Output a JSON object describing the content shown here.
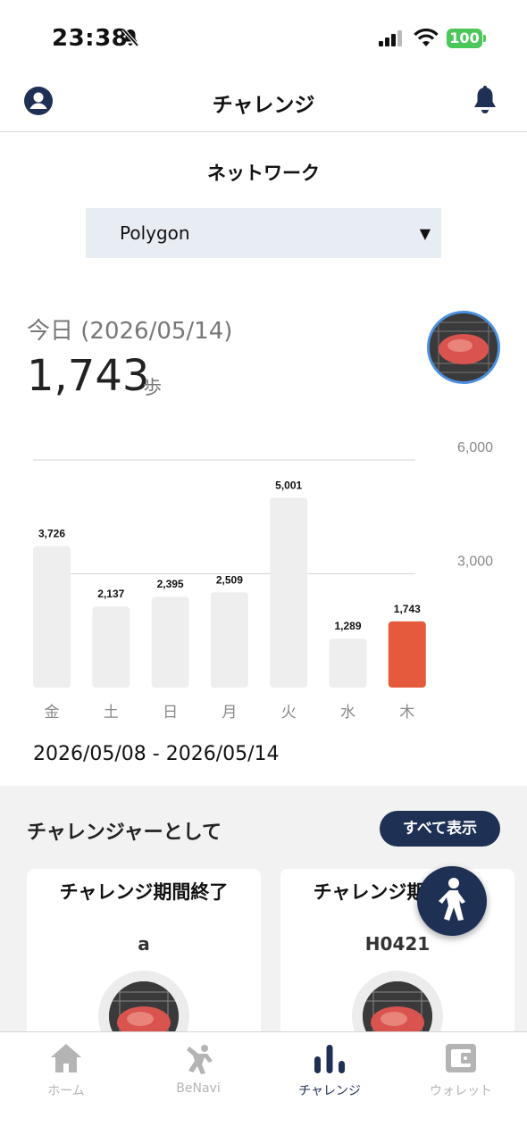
{
  "status_bar": {
    "time": "23:38",
    "battery": "100"
  },
  "header": {
    "title": "チャレンジ"
  },
  "network": {
    "label": "ネットワーク",
    "selected": "Polygon"
  },
  "today": {
    "label": "今日 (2026/05/14)",
    "steps": "1,743",
    "unit": "歩"
  },
  "chart_data": {
    "type": "bar",
    "categories": [
      "金",
      "土",
      "日",
      "月",
      "火",
      "水",
      "木"
    ],
    "values": [
      3726,
      2137,
      2395,
      2509,
      5001,
      1289,
      1743
    ],
    "value_labels": [
      "3,726",
      "2,137",
      "2,395",
      "2,509",
      "5,001",
      "1,289",
      "1,743"
    ],
    "y_ticks": [
      "6,000",
      "3,000"
    ],
    "ylim": [
      0,
      6000
    ],
    "colors": {
      "default": "#eeeeee",
      "highlight": "#e55a3c"
    },
    "highlight_index": 6
  },
  "date_range": "2026/05/08 - 2026/05/14",
  "challenger": {
    "title": "チャレンジャーとして",
    "show_all": "すべて表示",
    "cards": [
      {
        "status": "チャレンジ期間終了",
        "name": "a"
      },
      {
        "status": "チャレンジ期間終了",
        "name": "H0421"
      }
    ]
  },
  "tabs": [
    {
      "label": "ホーム",
      "icon": "home-icon"
    },
    {
      "label": "BeNavi",
      "icon": "benavi-icon"
    },
    {
      "label": "チャレンジ",
      "icon": "chart-bars-icon",
      "active": true
    },
    {
      "label": "ウォレット",
      "icon": "wallet-icon"
    }
  ]
}
